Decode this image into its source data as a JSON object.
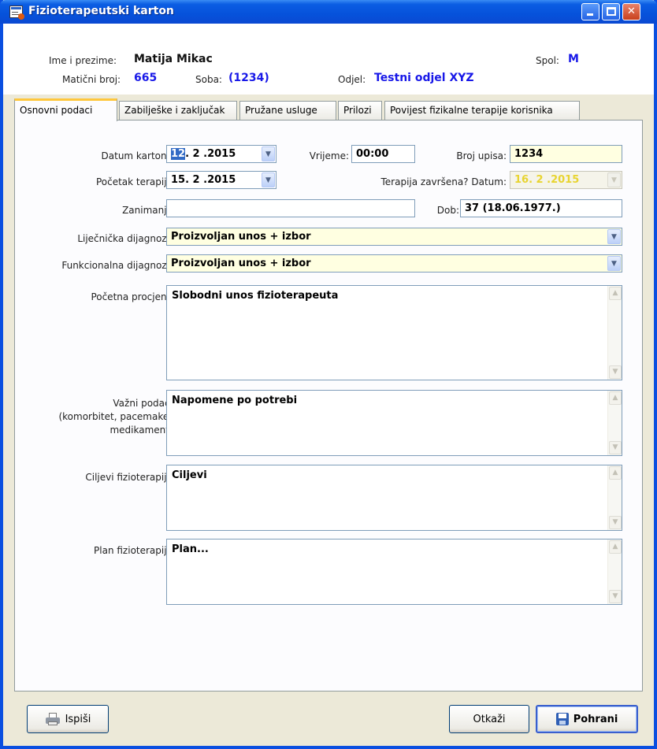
{
  "window": {
    "title": "Fizioterapeutski karton"
  },
  "header": {
    "name_label": "Ime i prezime:",
    "name_value": "Matija Mikac",
    "spol_label": "Spol:",
    "spol_value": "M",
    "mbr_label": "Matični broj:",
    "mbr_value": "665",
    "soba_label": "Soba:",
    "soba_value": "(1234)",
    "odjel_label": "Odjel:",
    "odjel_value": "Testni odjel XYZ"
  },
  "tabs": [
    {
      "label": "Osnovni podaci"
    },
    {
      "label": "Zabilješke i zaključak"
    },
    {
      "label": "Pružane usluge"
    },
    {
      "label": "Prilozi"
    },
    {
      "label": "Povijest fizikalne terapije korisnika"
    }
  ],
  "form": {
    "datum_label": "Datum kartona:",
    "datum_day": "12",
    "datum_rest": ". 2 .2015",
    "vrijeme_label": "Vrijeme:",
    "vrijeme_value": "00:00",
    "broj_label": "Broj upisa:",
    "broj_value": "1234",
    "pocetak_label": "Početak terapije:",
    "pocetak_value": "15. 2 .2015",
    "zavrsena_label": "Terapija završena? Datum:",
    "zavrsena_value": "16. 2 .2015",
    "zanimanje_label": "Zanimanje:",
    "zanimanje_value": "",
    "dob_label": "Dob:",
    "dob_value": "37  (18.06.1977.)",
    "lij_label": "Liječnička dijagnoza:",
    "lij_value": "Proizvoljan unos + izbor",
    "funk_label": "Funkcionalna dijagnoza:",
    "funk_value": "Proizvoljan unos + izbor",
    "procjena_label": "Početna procjena:",
    "procjena_value": "Slobodni unos fizioterapeuta",
    "vazni_label_1": "Važni podaci:",
    "vazni_label_2": "(komorbitet, pacemaker,",
    "vazni_label_3": "medikamenti)",
    "vazni_value": "Napomene po potrebi",
    "ciljevi_label": "Ciljevi fizioterapije:",
    "ciljevi_value": "Ciljevi",
    "plan_label": "Plan fizioterapije:",
    "plan_value": "Plan..."
  },
  "buttons": {
    "print": "Ispiši",
    "cancel": "Otkaži",
    "save": "Pohrani"
  },
  "colors": {
    "title_blue": "#0652DB",
    "value_blue": "#1818E8",
    "yellow_field": "#FFFFE1",
    "tab_accent": "#FFC73C"
  }
}
